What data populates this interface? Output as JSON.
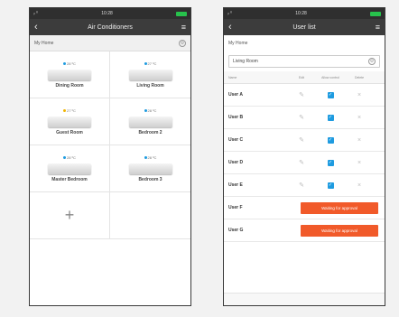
{
  "phone1": {
    "status": {
      "left": "ᵢₗ ⁰",
      "time": "10:28"
    },
    "title": "Air Conditioners",
    "home": "My Home",
    "rooms": [
      {
        "temp": "28 ºC",
        "dot_color": "#1e9be0",
        "label": "Dining Room"
      },
      {
        "temp": "27 ºC",
        "dot_color": "#1e9be0",
        "label": "Living Room"
      },
      {
        "temp": "27 ºC",
        "dot_color": "#f0b400",
        "label": "Guest Room"
      },
      {
        "temp": "28 ºC",
        "dot_color": "#1e9be0",
        "label": "Bedroom 2"
      },
      {
        "temp": "28 ºC",
        "dot_color": "#1e9be0",
        "label": "Master Bedroom"
      },
      {
        "temp": "28 ºC",
        "dot_color": "#1e9be0",
        "label": "Bedroom 3"
      }
    ],
    "add_symbol": "+"
  },
  "phone2": {
    "status": {
      "left": "ᵢₗ ⁰",
      "time": "10:28"
    },
    "title": "User list",
    "home": "My Home",
    "room": "Living Room",
    "columns": {
      "name": "Name",
      "edit": "Edit",
      "allow": "Allow control",
      "delete": "Delete"
    },
    "users": [
      {
        "name": "User A"
      },
      {
        "name": "User B"
      },
      {
        "name": "User C"
      },
      {
        "name": "User D"
      },
      {
        "name": "User E"
      }
    ],
    "pending": [
      {
        "name": "User F",
        "button": "Waiting for approval"
      },
      {
        "name": "User G",
        "button": "Waiting for approval"
      }
    ]
  },
  "colors": {
    "accent": "#1e9be0",
    "approval": "#f15a2a",
    "title_bar": "#3c3c3c"
  }
}
